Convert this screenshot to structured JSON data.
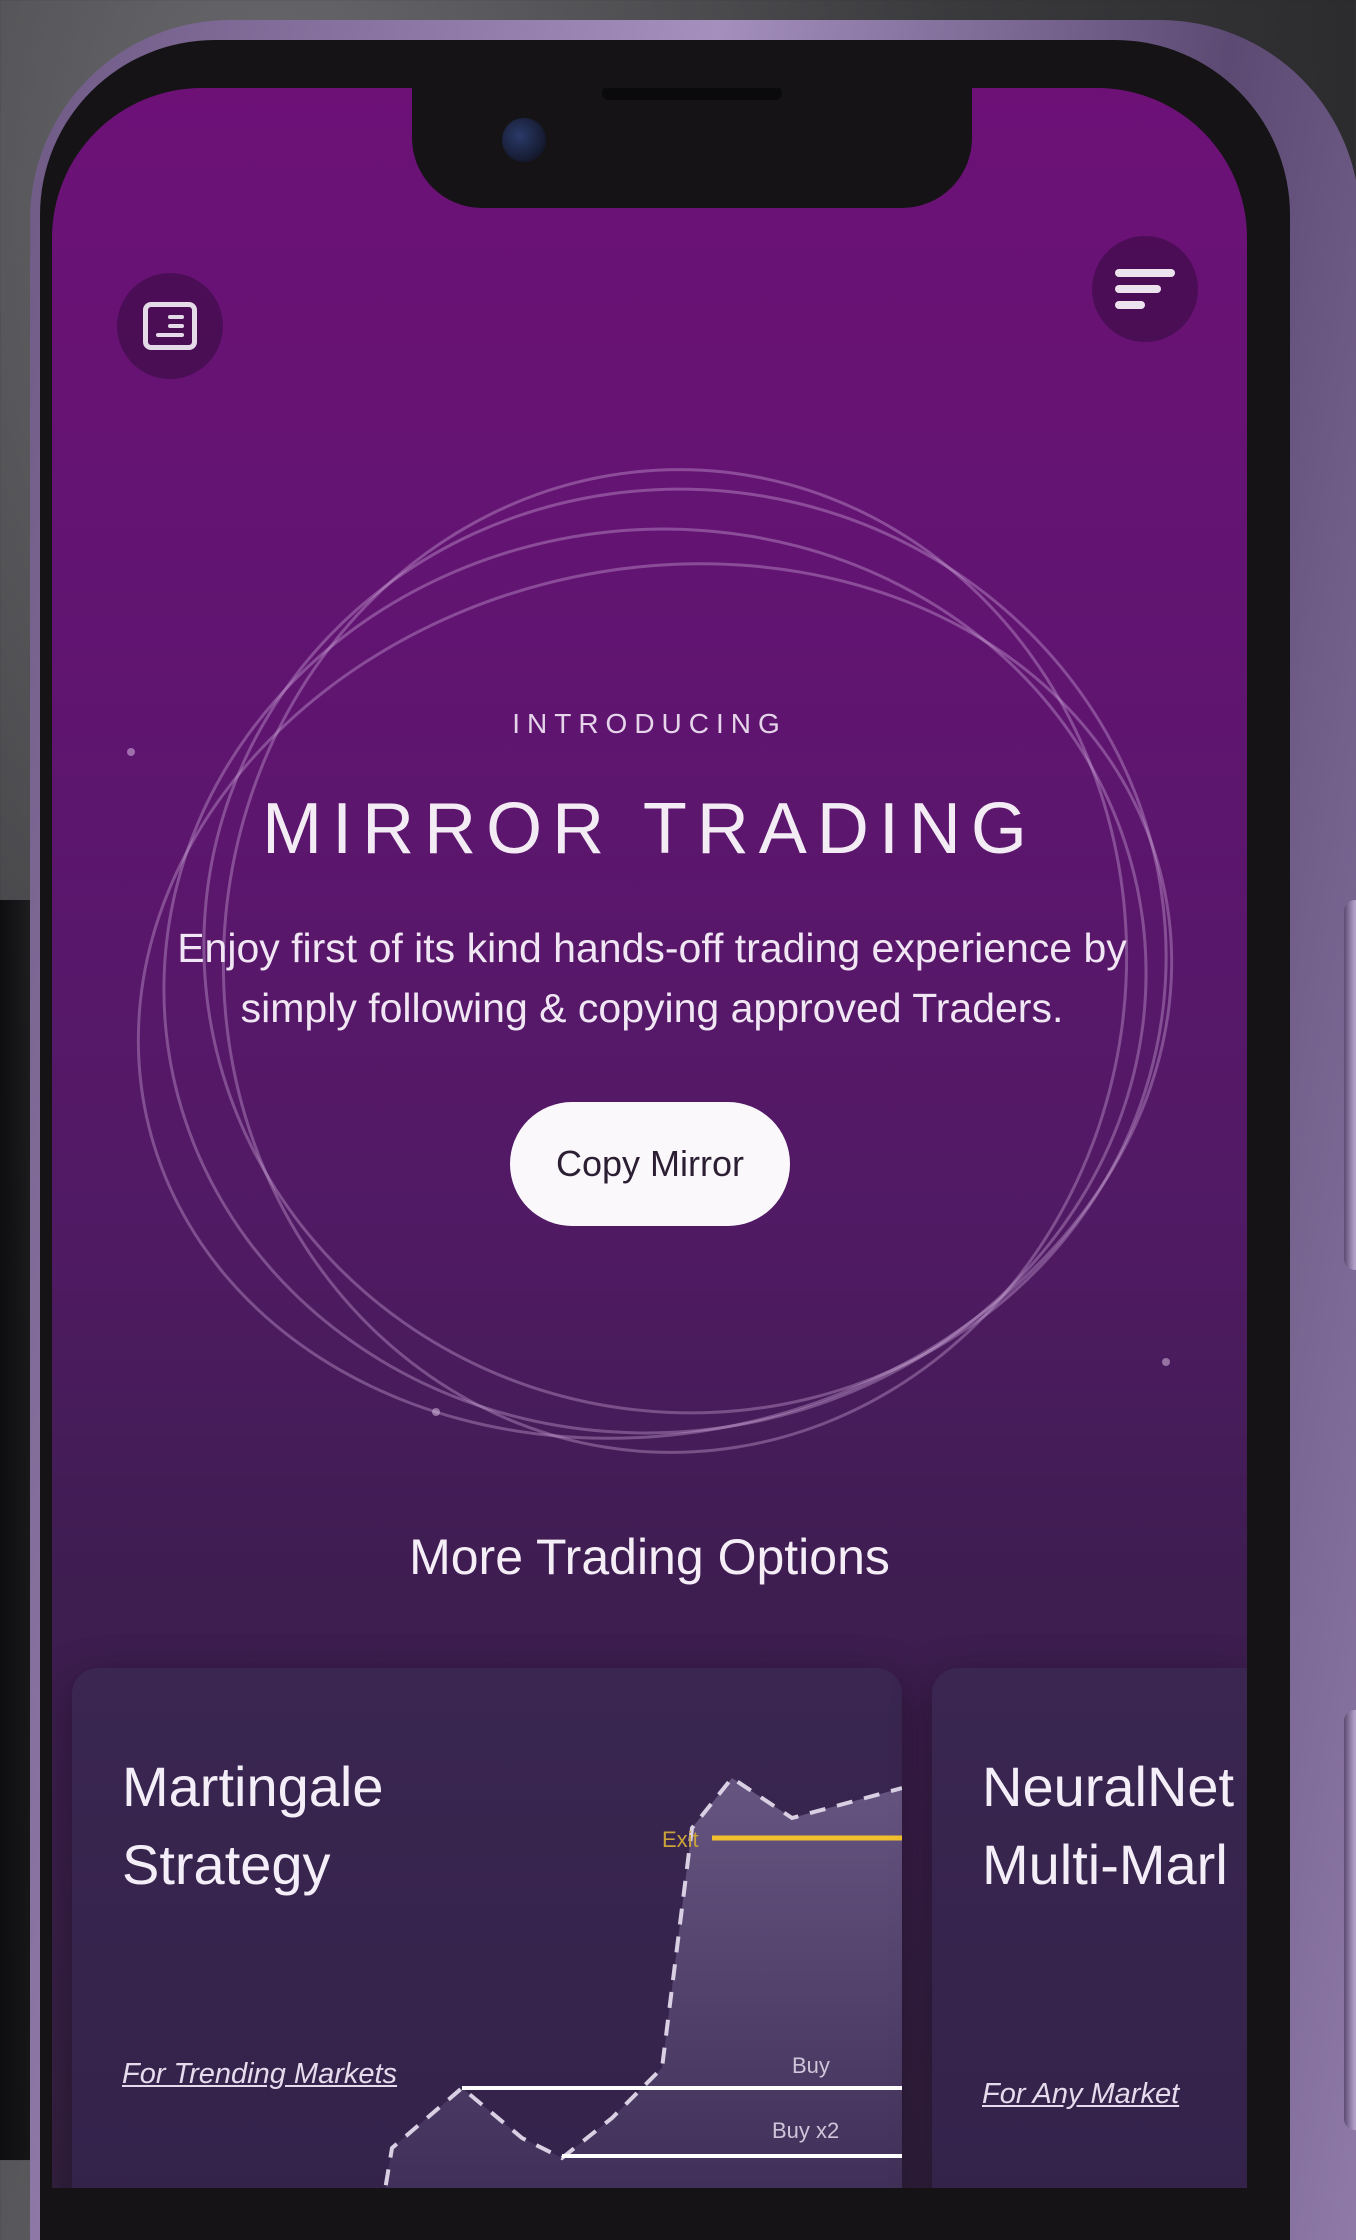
{
  "hero": {
    "tag": "INTRODUCING",
    "title": "MIRROR TRADING",
    "description_line1": "Enjoy first of its kind hands-off trading experience by",
    "description_line2": "simply following & copying approved Traders.",
    "cta_label": "Copy Mirror"
  },
  "toolbar": {
    "left_icon": "document-icon",
    "right_icon": "sort-icon"
  },
  "more_options": {
    "title": "More Trading Options",
    "cards": [
      {
        "title_line1": "Martingale",
        "title_line2": "Strategy",
        "subtitle": "For Trending Markets",
        "chart_labels": {
          "exit": "Exit",
          "buy": "Buy",
          "buy_x2": "Buy x2"
        }
      },
      {
        "title_line1": "NeuralNet",
        "title_line2": "Multi-Marl",
        "subtitle": "For Any Market"
      }
    ]
  },
  "colors": {
    "screen_top": "#6d1177",
    "screen_bottom": "#33203f",
    "card_bg": "#3a2650",
    "exit_line": "#f2c12e",
    "cta_bg": "#fbf8fc"
  }
}
